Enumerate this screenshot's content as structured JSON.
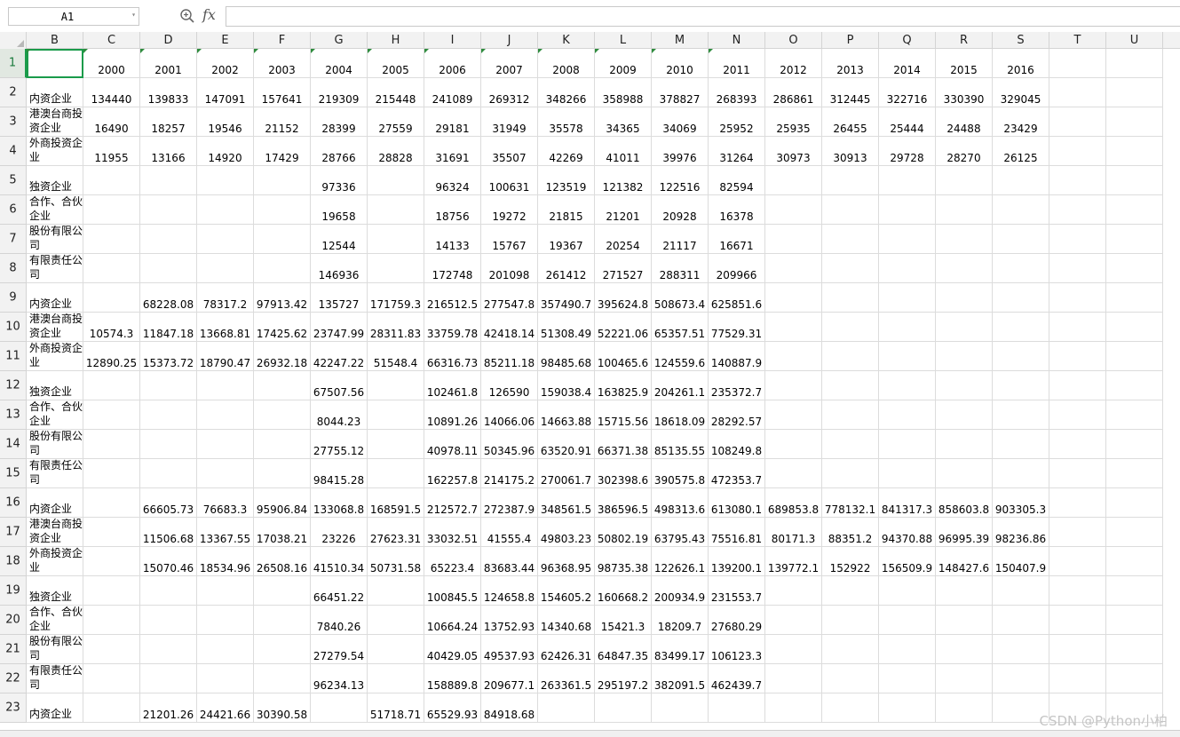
{
  "formula_bar": {
    "name_box": "A1",
    "formula": ""
  },
  "icons": {
    "zoom": "zoom-search-icon",
    "fx": "fx-icon"
  },
  "fx_label": "fx",
  "columns": [
    "B",
    "C",
    "D",
    "E",
    "F",
    "G",
    "H",
    "I",
    "J",
    "K",
    "L",
    "M",
    "N",
    "O",
    "P",
    "Q",
    "R",
    "S",
    "T",
    "U"
  ],
  "rows": [
    {
      "num": "1",
      "cells": [
        "",
        "2000",
        "2001",
        "2002",
        "2003",
        "2004",
        "2005",
        "2006",
        "2007",
        "2008",
        "2009",
        "2010",
        "2011",
        "2012",
        "2013",
        "2014",
        "2015",
        "2016",
        "",
        ""
      ]
    },
    {
      "num": "2",
      "cells": [
        "内资企业",
        "134440",
        "139833",
        "147091",
        "157641",
        "219309",
        "215448",
        "241089",
        "269312",
        "348266",
        "358988",
        "378827",
        "268393",
        "286861",
        "312445",
        "322716",
        "330390",
        "329045",
        "",
        ""
      ]
    },
    {
      "num": "3",
      "cells": [
        "港澳台商投资企业",
        "16490",
        "18257",
        "19546",
        "21152",
        "28399",
        "27559",
        "29181",
        "31949",
        "35578",
        "34365",
        "34069",
        "25952",
        "25935",
        "26455",
        "25444",
        "24488",
        "23429",
        "",
        ""
      ]
    },
    {
      "num": "4",
      "cells": [
        "外商投资企业",
        "11955",
        "13166",
        "14920",
        "17429",
        "28766",
        "28828",
        "31691",
        "35507",
        "42269",
        "41011",
        "39976",
        "31264",
        "30973",
        "30913",
        "29728",
        "28270",
        "26125",
        "",
        ""
      ]
    },
    {
      "num": "5",
      "cells": [
        "独资企业",
        "",
        "",
        "",
        "",
        "97336",
        "",
        "96324",
        "100631",
        "123519",
        "121382",
        "122516",
        "82594",
        "",
        "",
        "",
        "",
        "",
        "",
        ""
      ]
    },
    {
      "num": "6",
      "cells": [
        "合作、合伙企业",
        "",
        "",
        "",
        "",
        "19658",
        "",
        "18756",
        "19272",
        "21815",
        "21201",
        "20928",
        "16378",
        "",
        "",
        "",
        "",
        "",
        "",
        ""
      ]
    },
    {
      "num": "7",
      "cells": [
        "股份有限公司",
        "",
        "",
        "",
        "",
        "12544",
        "",
        "14133",
        "15767",
        "19367",
        "20254",
        "21117",
        "16671",
        "",
        "",
        "",
        "",
        "",
        "",
        ""
      ]
    },
    {
      "num": "8",
      "cells": [
        "有限责任公司",
        "",
        "",
        "",
        "",
        "146936",
        "",
        "172748",
        "201098",
        "261412",
        "271527",
        "288311",
        "209966",
        "",
        "",
        "",
        "",
        "",
        "",
        ""
      ]
    },
    {
      "num": "9",
      "cells": [
        "内资企业",
        "",
        "68228.08",
        "78317.2",
        "97913.42",
        "135727",
        "171759.3",
        "216512.5",
        "277547.8",
        "357490.7",
        "395624.8",
        "508673.4",
        "625851.6",
        "",
        "",
        "",
        "",
        "",
        "",
        ""
      ]
    },
    {
      "num": "10",
      "cells": [
        "港澳台商投资企业",
        "10574.3",
        "11847.18",
        "13668.81",
        "17425.62",
        "23747.99",
        "28311.83",
        "33759.78",
        "42418.14",
        "51308.49",
        "52221.06",
        "65357.51",
        "77529.31",
        "",
        "",
        "",
        "",
        "",
        "",
        ""
      ]
    },
    {
      "num": "11",
      "cells": [
        "外商投资企业",
        "12890.25",
        "15373.72",
        "18790.47",
        "26932.18",
        "42247.22",
        "51548.4",
        "66316.73",
        "85211.18",
        "98485.68",
        "100465.6",
        "124559.6",
        "140887.9",
        "",
        "",
        "",
        "",
        "",
        "",
        ""
      ]
    },
    {
      "num": "12",
      "cells": [
        "独资企业",
        "",
        "",
        "",
        "",
        "67507.56",
        "",
        "102461.8",
        "126590",
        "159038.4",
        "163825.9",
        "204261.1",
        "235372.7",
        "",
        "",
        "",
        "",
        "",
        "",
        ""
      ]
    },
    {
      "num": "13",
      "cells": [
        "合作、合伙企业",
        "",
        "",
        "",
        "",
        "8044.23",
        "",
        "10891.26",
        "14066.06",
        "14663.88",
        "15715.56",
        "18618.09",
        "28292.57",
        "",
        "",
        "",
        "",
        "",
        "",
        ""
      ]
    },
    {
      "num": "14",
      "cells": [
        "股份有限公司",
        "",
        "",
        "",
        "",
        "27755.12",
        "",
        "40978.11",
        "50345.96",
        "63520.91",
        "66371.38",
        "85135.55",
        "108249.8",
        "",
        "",
        "",
        "",
        "",
        "",
        ""
      ]
    },
    {
      "num": "15",
      "cells": [
        "有限责任公司",
        "",
        "",
        "",
        "",
        "98415.28",
        "",
        "162257.8",
        "214175.2",
        "270061.7",
        "302398.6",
        "390575.8",
        "472353.7",
        "",
        "",
        "",
        "",
        "",
        "",
        ""
      ]
    },
    {
      "num": "16",
      "cells": [
        "内资企业",
        "",
        "66605.73",
        "76683.3",
        "95906.84",
        "133068.8",
        "168591.5",
        "212572.7",
        "272387.9",
        "348561.5",
        "386596.5",
        "498313.6",
        "613080.1",
        "689853.8",
        "778132.1",
        "841317.3",
        "858603.8",
        "903305.3",
        "",
        ""
      ]
    },
    {
      "num": "17",
      "cells": [
        "港澳台商投资企业",
        "",
        "11506.68",
        "13367.55",
        "17038.21",
        "23226",
        "27623.31",
        "33032.51",
        "41555.4",
        "49803.23",
        "50802.19",
        "63795.43",
        "75516.81",
        "80171.3",
        "88351.2",
        "94370.88",
        "96995.39",
        "98236.86",
        "",
        ""
      ]
    },
    {
      "num": "18",
      "cells": [
        "外商投资企业",
        "",
        "15070.46",
        "18534.96",
        "26508.16",
        "41510.34",
        "50731.58",
        "65223.4",
        "83683.44",
        "96368.95",
        "98735.38",
        "122626.1",
        "139200.1",
        "139772.1",
        "152922",
        "156509.9",
        "148427.6",
        "150407.9",
        "",
        ""
      ]
    },
    {
      "num": "19",
      "cells": [
        "独资企业",
        "",
        "",
        "",
        "",
        "66451.22",
        "",
        "100845.5",
        "124658.8",
        "154605.2",
        "160668.2",
        "200934.9",
        "231553.7",
        "",
        "",
        "",
        "",
        "",
        "",
        ""
      ]
    },
    {
      "num": "20",
      "cells": [
        "合作、合伙企业",
        "",
        "",
        "",
        "",
        "7840.26",
        "",
        "10664.24",
        "13752.93",
        "14340.68",
        "15421.3",
        "18209.7",
        "27680.29",
        "",
        "",
        "",
        "",
        "",
        "",
        ""
      ]
    },
    {
      "num": "21",
      "cells": [
        "股份有限公司",
        "",
        "",
        "",
        "",
        "27279.54",
        "",
        "40429.05",
        "49537.93",
        "62426.31",
        "64847.35",
        "83499.17",
        "106123.3",
        "",
        "",
        "",
        "",
        "",
        "",
        ""
      ]
    },
    {
      "num": "22",
      "cells": [
        "有限责任公司",
        "",
        "",
        "",
        "",
        "96234.13",
        "",
        "158889.8",
        "209677.1",
        "263361.5",
        "295197.2",
        "382091.5",
        "462439.7",
        "",
        "",
        "",
        "",
        "",
        "",
        ""
      ]
    },
    {
      "num": "23",
      "cells": [
        "内资企业",
        "",
        "21201.26",
        "24421.66",
        "30390.58",
        "",
        "51718.71",
        "65529.93",
        "84918.68",
        "",
        "",
        "",
        "",
        "",
        "",
        "",
        "",
        "",
        "",
        ""
      ]
    }
  ],
  "watermark": "CSDN @Python小柏"
}
